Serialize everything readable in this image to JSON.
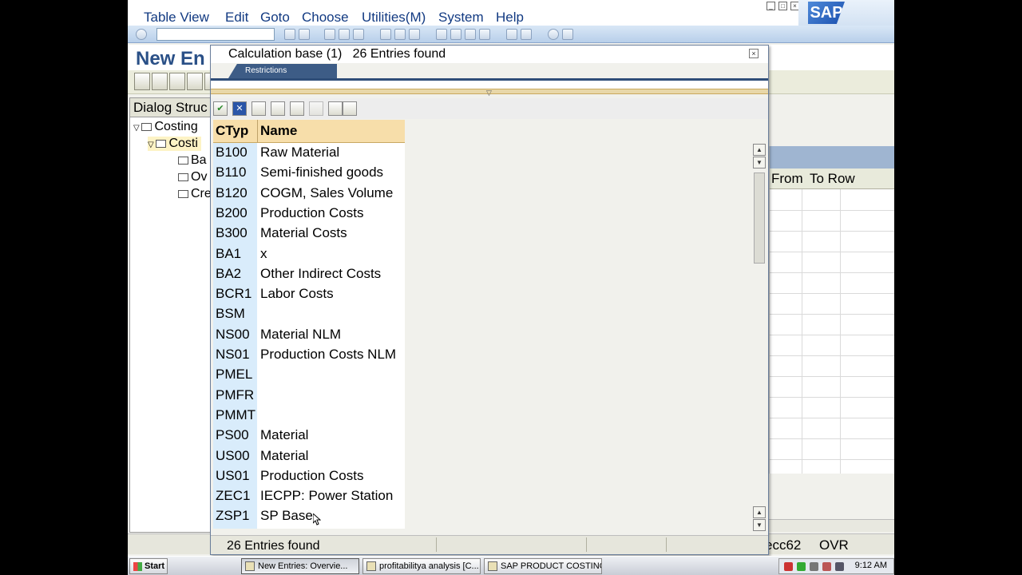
{
  "menubar": {
    "items": [
      "Table View",
      "Edit",
      "Goto",
      "Choose",
      "Utilities(M)",
      "System",
      "Help"
    ],
    "logo": "SAP"
  },
  "toolbar": {
    "command_field": ""
  },
  "page": {
    "title": "New En"
  },
  "dialog_structure": {
    "header": "Dialog Struc",
    "items": [
      {
        "label": "Costing"
      },
      {
        "label": "Costi"
      },
      {
        "label": "Ba"
      },
      {
        "label": "Ov"
      },
      {
        "label": "Cre"
      }
    ]
  },
  "right_table": {
    "columns": [
      "From",
      "To Row"
    ]
  },
  "popup": {
    "title_number": "Calculation base (1)",
    "title_count": "26 Entries found",
    "tab_restrictions": "Restrictions",
    "columns": {
      "key": "CTyp",
      "name": "Name"
    },
    "rows": [
      {
        "k": "B100",
        "n": "Raw Material"
      },
      {
        "k": "B110",
        "n": "Semi-finished goods"
      },
      {
        "k": "B120",
        "n": "COGM, Sales Volume"
      },
      {
        "k": "B200",
        "n": "Production Costs"
      },
      {
        "k": "B300",
        "n": "Material Costs"
      },
      {
        "k": "BA1",
        "n": "x"
      },
      {
        "k": "BA2",
        "n": "Other Indirect Costs"
      },
      {
        "k": "BCR1",
        "n": "Labor Costs"
      },
      {
        "k": "BSM",
        "n": ""
      },
      {
        "k": "NS00",
        "n": "Material NLM"
      },
      {
        "k": "NS01",
        "n": "Production Costs NLM"
      },
      {
        "k": "PMEL",
        "n": ""
      },
      {
        "k": "PMFR",
        "n": ""
      },
      {
        "k": "PMMT",
        "n": ""
      },
      {
        "k": "PS00",
        "n": "Material"
      },
      {
        "k": "US00",
        "n": "Material"
      },
      {
        "k": "US01",
        "n": "Production Costs"
      },
      {
        "k": "ZEC1",
        "n": "IECPP: Power Station"
      },
      {
        "k": "ZSP1",
        "n": "SP Base"
      }
    ],
    "status": "26 Entries found"
  },
  "statusbar": {
    "system": "ecc62",
    "mode": "OVR"
  },
  "taskbar": {
    "start": "Start",
    "tasks": [
      "New Entries: Overvie...",
      "profitabilitya analysis [C...",
      "SAP PRODUCT COSTING"
    ],
    "clock": "9:12 AM"
  }
}
